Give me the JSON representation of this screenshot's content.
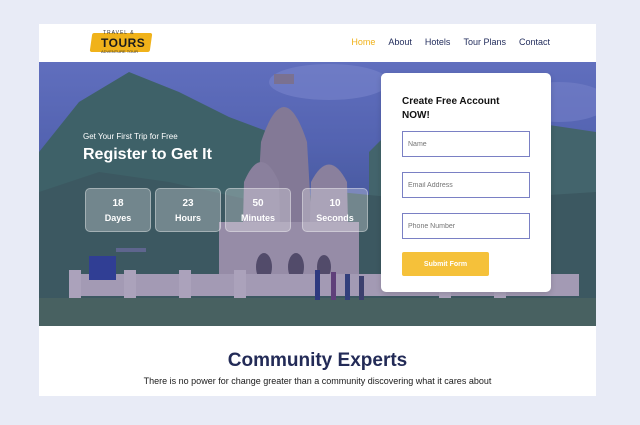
{
  "brand": {
    "logo_text": "TOURS",
    "logo_small": "TRAVEL &",
    "logo_tagline": "ADVENTURE TOUR",
    "accent_color": "#f0b21a"
  },
  "nav": {
    "items": [
      {
        "label": "Home",
        "active": true
      },
      {
        "label": "About",
        "active": false
      },
      {
        "label": "Hotels",
        "active": false
      },
      {
        "label": "Tour Plans",
        "active": false
      },
      {
        "label": "Contact",
        "active": false
      }
    ]
  },
  "hero": {
    "subtitle": "Get Your First Trip for Free",
    "title": "Register to Get It",
    "countdown": [
      {
        "value": "18",
        "label": "Dayes"
      },
      {
        "value": "23",
        "label": "Hours"
      },
      {
        "value": "50",
        "label": "Minutes"
      },
      {
        "value": "10",
        "label": "Seconds"
      }
    ]
  },
  "form": {
    "title": "Create Free Account NOW!",
    "name_placeholder": "Name",
    "email_placeholder": "Email Address",
    "phone_placeholder": "Phone Number",
    "submit_label": "Submit Form"
  },
  "section": {
    "title": "Community Experts",
    "text": "There is no power for change greater than a community discovering what it cares about"
  }
}
